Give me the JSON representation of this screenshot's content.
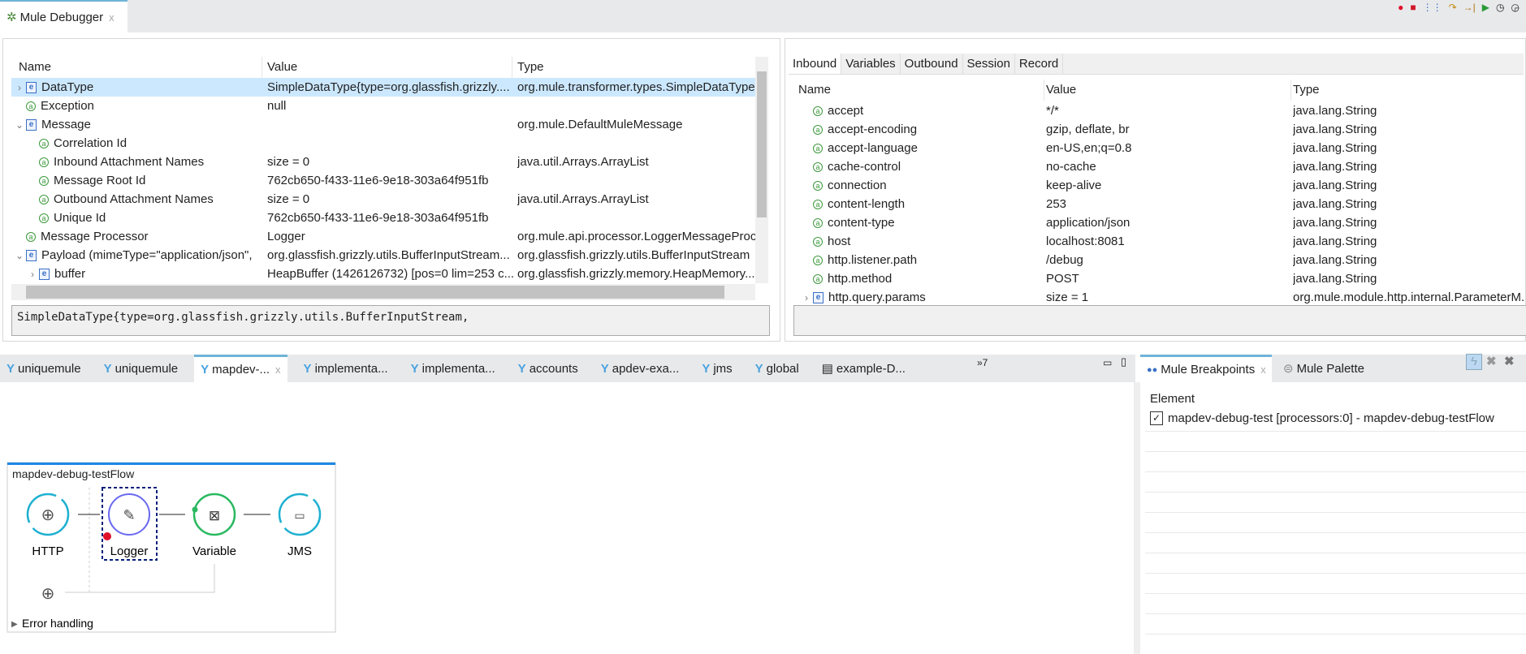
{
  "top_tab": {
    "label": "Mule Debugger",
    "close": "x"
  },
  "toolbar_icons": [
    "clear-icon",
    "stop-icon",
    "evaluate-icon",
    "step-over-icon",
    "next-processor-icon",
    "resume-icon",
    "timer-start-icon",
    "timer-stop-icon"
  ],
  "left": {
    "headers": {
      "name": "Name",
      "value": "Value",
      "type": "Type"
    },
    "rows": [
      {
        "exp": ">",
        "icon": "e",
        "indent": 0,
        "name": "DataType",
        "value": "SimpleDataType{type=org.glassfish.grizzly....",
        "type": "org.mule.transformer.types.SimpleDataType",
        "selected": true
      },
      {
        "exp": "",
        "icon": "a",
        "indent": 0,
        "name": "Exception",
        "value": "null",
        "type": ""
      },
      {
        "exp": "v",
        "icon": "e",
        "indent": 0,
        "name": "Message",
        "value": "",
        "type": "org.mule.DefaultMuleMessage"
      },
      {
        "exp": "",
        "icon": "a",
        "indent": 1,
        "name": "Correlation Id",
        "value": "",
        "type": ""
      },
      {
        "exp": "",
        "icon": "a",
        "indent": 1,
        "name": "Inbound Attachment Names",
        "value": "size = 0",
        "type": "java.util.Arrays.ArrayList"
      },
      {
        "exp": "",
        "icon": "a",
        "indent": 1,
        "name": "Message Root Id",
        "value": "762cb650-f433-11e6-9e18-303a64f951fb",
        "type": ""
      },
      {
        "exp": "",
        "icon": "a",
        "indent": 1,
        "name": "Outbound Attachment Names",
        "value": "size = 0",
        "type": "java.util.Arrays.ArrayList"
      },
      {
        "exp": "",
        "icon": "a",
        "indent": 1,
        "name": "Unique Id",
        "value": "762cb650-f433-11e6-9e18-303a64f951fb",
        "type": ""
      },
      {
        "exp": "",
        "icon": "a",
        "indent": 0,
        "name": "Message Processor",
        "value": "Logger",
        "type": "org.mule.api.processor.LoggerMessageProc..."
      },
      {
        "exp": "v",
        "icon": "e",
        "indent": 0,
        "name": "Payload (mimeType=\"application/json\",",
        "value": "org.glassfish.grizzly.utils.BufferInputStream...",
        "type": "org.glassfish.grizzly.utils.BufferInputStream"
      },
      {
        "exp": ">",
        "icon": "e",
        "indent": 1,
        "name": "buffer",
        "value": "HeapBuffer (1426126732) [pos=0 lim=253 c...",
        "type": "org.glassfish.grizzly.memory.HeapMemory..."
      }
    ],
    "detail": "SimpleDataType{type=org.glassfish.grizzly.utils.BufferInputStream,"
  },
  "right": {
    "tabs": [
      "Inbound",
      "Variables",
      "Outbound",
      "Session",
      "Record"
    ],
    "active_tab": "Inbound",
    "headers": {
      "name": "Name",
      "value": "Value",
      "type": "Type"
    },
    "rows": [
      {
        "exp": "",
        "icon": "a",
        "name": "accept",
        "value": "*/*",
        "type": "java.lang.String"
      },
      {
        "exp": "",
        "icon": "a",
        "name": "accept-encoding",
        "value": "gzip, deflate, br",
        "type": "java.lang.String"
      },
      {
        "exp": "",
        "icon": "a",
        "name": "accept-language",
        "value": "en-US,en;q=0.8",
        "type": "java.lang.String"
      },
      {
        "exp": "",
        "icon": "a",
        "name": "cache-control",
        "value": "no-cache",
        "type": "java.lang.String"
      },
      {
        "exp": "",
        "icon": "a",
        "name": "connection",
        "value": "keep-alive",
        "type": "java.lang.String"
      },
      {
        "exp": "",
        "icon": "a",
        "name": "content-length",
        "value": "253",
        "type": "java.lang.String"
      },
      {
        "exp": "",
        "icon": "a",
        "name": "content-type",
        "value": "application/json",
        "type": "java.lang.String"
      },
      {
        "exp": "",
        "icon": "a",
        "name": "host",
        "value": "localhost:8081",
        "type": "java.lang.String"
      },
      {
        "exp": "",
        "icon": "a",
        "name": "http.listener.path",
        "value": "/debug",
        "type": "java.lang.String"
      },
      {
        "exp": "",
        "icon": "a",
        "name": "http.method",
        "value": "POST",
        "type": "java.lang.String"
      },
      {
        "exp": ">",
        "icon": "e",
        "name": "http.query.params",
        "value": "size = 1",
        "type": "org.mule.module.http.internal.ParameterM..."
      }
    ]
  },
  "editor": {
    "tabs": [
      {
        "label": "uniquemule"
      },
      {
        "label": "uniquemule"
      },
      {
        "label": "mapdev-...",
        "active": true
      },
      {
        "label": "implementa..."
      },
      {
        "label": "implementa..."
      },
      {
        "label": "accounts"
      },
      {
        "label": "apdev-exa..."
      },
      {
        "label": "jms"
      },
      {
        "label": "global"
      },
      {
        "label": "example-D...",
        "doc": true
      }
    ],
    "overflow": "»7",
    "flow": {
      "title": "mapdev-debug-testFlow",
      "nodes": [
        "HTTP",
        "Logger",
        "Variable",
        "JMS"
      ],
      "error_handling": "Error handling"
    }
  },
  "breakpoints": {
    "tabs": [
      "Mule Breakpoints",
      "Mule Palette"
    ],
    "header": "Element",
    "items": [
      {
        "label": "mapdev-debug-test [processors:0] - mapdev-debug-testFlow",
        "checked": true
      }
    ]
  }
}
